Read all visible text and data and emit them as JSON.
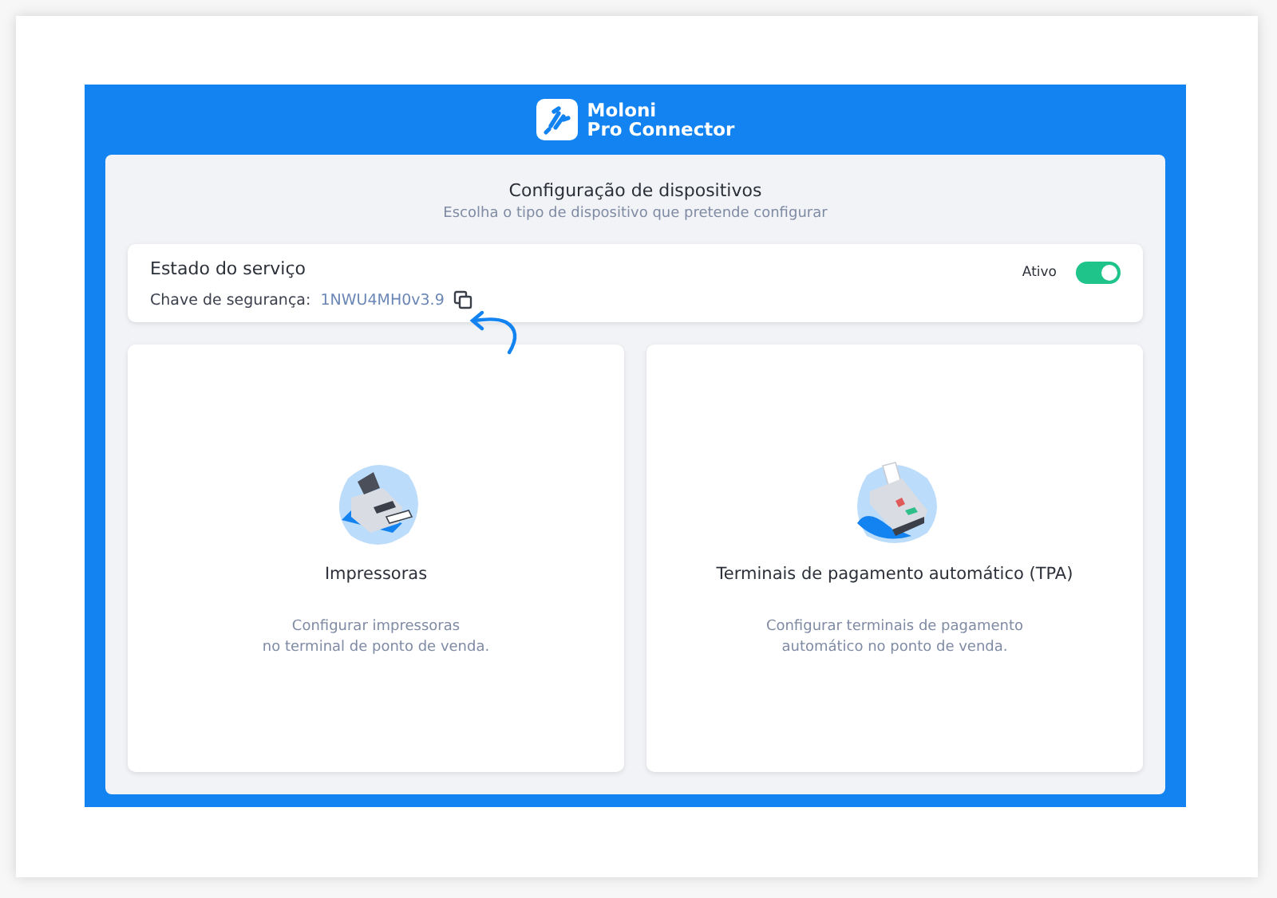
{
  "app": {
    "name_lines": [
      "Moloni",
      "Pro Connector"
    ]
  },
  "panel": {
    "title": "Configuração de dispositivos",
    "subtitle": "Escolha o tipo de dispositivo que pretende configurar"
  },
  "service": {
    "title": "Estado do serviço",
    "key_label": "Chave de segurança:",
    "key_value": "1NWU4MH0v3.9",
    "status_label": "Ativo",
    "on": true
  },
  "devices": [
    {
      "kind": "printer",
      "title": "Impressoras",
      "description_lines": [
        "Configurar impressoras",
        "no terminal de ponto de venda."
      ]
    },
    {
      "kind": "terminal",
      "title": "Terminais de pagamento automático (TPA)",
      "description_lines": [
        "Configurar terminais de pagamento",
        "automático no ponto de venda."
      ]
    }
  ]
}
